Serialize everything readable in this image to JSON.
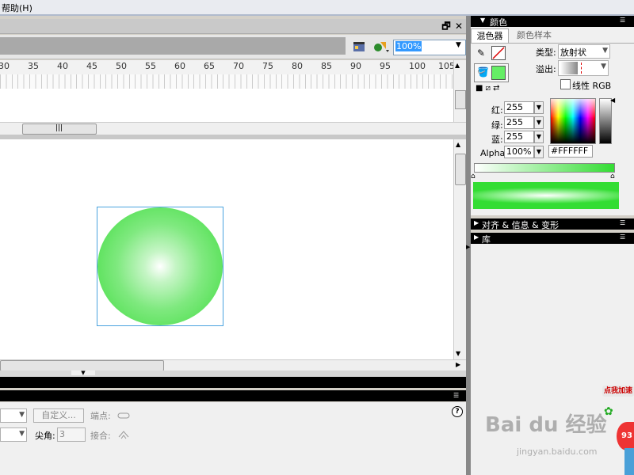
{
  "menu": {
    "help": "帮助(H)"
  },
  "window": {
    "restore": "🗗",
    "close": "✕"
  },
  "toolbar": {
    "zoom": "100%"
  },
  "timeline": {
    "ruler": [
      "30",
      "35",
      "40",
      "45",
      "50",
      "55",
      "60",
      "65",
      "70",
      "75",
      "80",
      "85",
      "90",
      "95",
      "100",
      "105"
    ]
  },
  "properties": {
    "custom_button": "自定义...",
    "cap_label": "端点:",
    "miter_label": "尖角:",
    "miter_value": "3",
    "join_label": "接合:",
    "help": "?"
  },
  "color_panel": {
    "title": "颜色",
    "tab_mixer": "混色器",
    "tab_swatches": "颜色样本",
    "type_label": "类型:",
    "type_value": "放射状",
    "overflow_label": "溢出:",
    "linear_rgb": "线性 RGB",
    "red_label": "红:",
    "red_value": "255",
    "green_label": "绿:",
    "green_value": "255",
    "blue_label": "蓝:",
    "blue_value": "255",
    "alpha_label": "Alpha:",
    "alpha_value": "100%",
    "hex_value": "#FFFFFF"
  },
  "panels": {
    "align": "对齐 & 信息 & 变形",
    "library": "库"
  },
  "baidu": {
    "speedup": "点我加速",
    "score": "93",
    "watermark": "Bai du 经验",
    "url": "jingyan.baidu.com"
  },
  "colors": {
    "fill_green": "#66ee66",
    "selection_blue": "#4aa3df",
    "panel_header": "#000000"
  }
}
